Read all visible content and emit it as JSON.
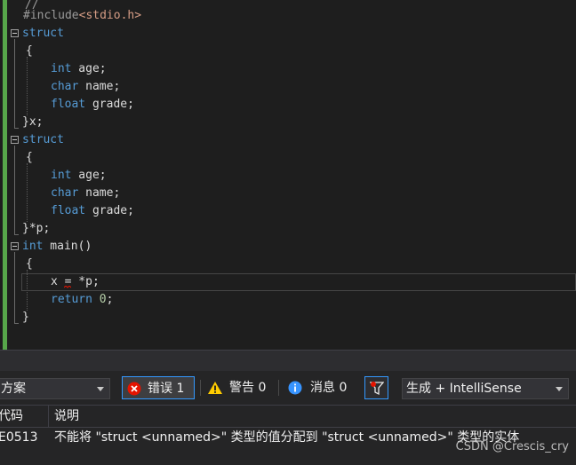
{
  "editor": {
    "lines": [
      {
        "tokens": [
          {
            "t": "//",
            "c": "pp"
          }
        ]
      },
      {
        "tokens": [
          {
            "t": "#include",
            "c": "pp"
          },
          {
            "t": "<stdio.h>",
            "c": "inc"
          }
        ]
      },
      {
        "tokens": [
          {
            "t": "struct",
            "c": "kw"
          }
        ]
      },
      {
        "tokens": [
          {
            "t": "{",
            "c": ""
          }
        ]
      },
      {
        "tokens": [
          {
            "t": "int",
            "c": "kw"
          },
          {
            "t": " age;",
            "c": ""
          }
        ]
      },
      {
        "tokens": [
          {
            "t": "char",
            "c": "kw"
          },
          {
            "t": " name;",
            "c": ""
          }
        ]
      },
      {
        "tokens": [
          {
            "t": "float",
            "c": "kw"
          },
          {
            "t": " grade;",
            "c": ""
          }
        ]
      },
      {
        "tokens": [
          {
            "t": "}x;",
            "c": ""
          }
        ]
      },
      {
        "tokens": [
          {
            "t": "struct",
            "c": "kw"
          }
        ]
      },
      {
        "tokens": [
          {
            "t": "{",
            "c": ""
          }
        ]
      },
      {
        "tokens": [
          {
            "t": "int",
            "c": "kw"
          },
          {
            "t": " age;",
            "c": ""
          }
        ]
      },
      {
        "tokens": [
          {
            "t": "char",
            "c": "kw"
          },
          {
            "t": " name;",
            "c": ""
          }
        ]
      },
      {
        "tokens": [
          {
            "t": "float",
            "c": "kw"
          },
          {
            "t": " grade;",
            "c": ""
          }
        ]
      },
      {
        "tokens": [
          {
            "t": "}*p;",
            "c": ""
          }
        ]
      },
      {
        "tokens": [
          {
            "t": "int",
            "c": "kw"
          },
          {
            "t": " main()",
            "c": ""
          }
        ]
      },
      {
        "tokens": [
          {
            "t": "{",
            "c": ""
          }
        ]
      },
      {
        "tokens": [
          {
            "t": "x = *p;",
            "c": ""
          }
        ]
      },
      {
        "tokens": [
          {
            "t": "return",
            "c": "kw"
          },
          {
            "t": " ",
            "c": ""
          },
          {
            "t": "0",
            "c": "num"
          },
          {
            "t": ";",
            "c": ""
          }
        ]
      },
      {
        "tokens": [
          {
            "t": "}",
            "c": ""
          }
        ]
      }
    ]
  },
  "error_list": {
    "scope_dropdown": "方案",
    "errors_label": "错误 1",
    "warnings_label": "警告 0",
    "messages_label": "消息 0",
    "build_dropdown": "生成 + IntelliSense",
    "columns": {
      "code": "代码",
      "description": "说明"
    },
    "rows": [
      {
        "code": "E0513",
        "description": "不能将 \"struct <unnamed>\" 类型的值分配到 \"struct <unnamed>\" 类型的实体"
      }
    ]
  },
  "watermark": "CSDN @Crescis_cry",
  "colors": {
    "keyword": "#569cd6",
    "include": "#d69d85",
    "number": "#b5cea8",
    "error": "#e51400",
    "warning": "#ffcc00",
    "info": "#3794ff",
    "accent": "#3399ff"
  }
}
